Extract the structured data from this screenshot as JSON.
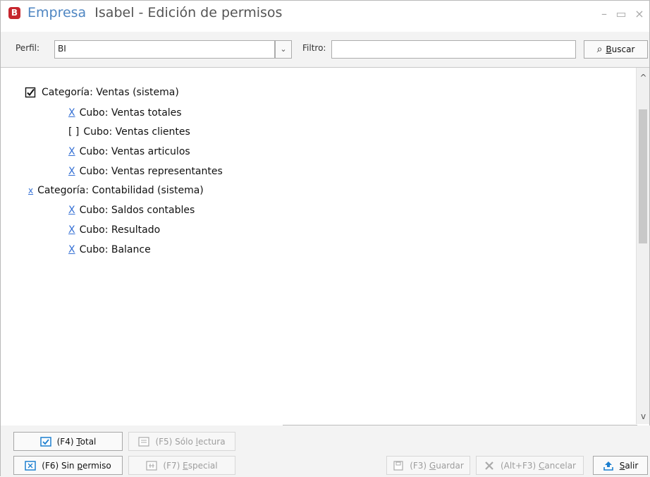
{
  "window": {
    "title_company": "Empresa",
    "title_rest": "Isabel - Edición de permisos",
    "app_icon": "company-logo-icon",
    "minimize_glyph": "–",
    "maximize_glyph": "▭",
    "close_glyph": "×"
  },
  "toolbar": {
    "perfil_label": "Perfil:",
    "perfil_value": "BI",
    "filtro_label": "Filtro:",
    "filtro_value": "",
    "buscar_icon": "search-icon",
    "buscar_underlined": "B",
    "buscar_rest": "uscar"
  },
  "tree": [
    {
      "type": "category",
      "status": "checked",
      "mark": "",
      "label": "Categoría: Ventas (sistema)"
    },
    {
      "type": "cube",
      "status": "full",
      "mark": "X",
      "label": "Cubo: Ventas totales"
    },
    {
      "type": "cube",
      "status": "none",
      "mark": "[ ]",
      "label": "Cubo: Ventas clientes"
    },
    {
      "type": "cube",
      "status": "full",
      "mark": "X",
      "label": "Cubo: Ventas articulos"
    },
    {
      "type": "cube",
      "status": "full",
      "mark": "X",
      "label": "Cubo: Ventas representantes"
    },
    {
      "type": "category",
      "status": "partial",
      "mark": "x",
      "label": "Categoría: Contabilidad (sistema)"
    },
    {
      "type": "cube",
      "status": "full",
      "mark": "X",
      "label": "Cubo: Saldos contables"
    },
    {
      "type": "cube",
      "status": "full",
      "mark": "X",
      "label": "Cubo: Resultado"
    },
    {
      "type": "cube",
      "status": "full",
      "mark": "X",
      "label": "Cubo: Balance"
    }
  ],
  "scrollbar": {
    "up": "^",
    "down": "v"
  },
  "buttons": {
    "total": {
      "prefix": "(F4) ",
      "underlined": "T",
      "rest": "otal",
      "icon": "checkbox-icon"
    },
    "solo_lectura": {
      "prefix": "(F5) Sólo ",
      "underlined": "l",
      "rest": "ectura",
      "icon": "readonly-icon"
    },
    "sin_permiso": {
      "prefix": "(F6) Sin ",
      "underlined": "p",
      "rest": "ermiso",
      "icon": "no-permission-icon"
    },
    "especial": {
      "prefix": "(F7) ",
      "underlined": "E",
      "rest": "special",
      "icon": "special-icon"
    },
    "guardar": {
      "prefix": "(F3) ",
      "underlined": "G",
      "rest": "uardar",
      "icon": "save-icon"
    },
    "cancelar": {
      "prefix": "(Alt+F3) ",
      "underlined": "C",
      "rest": "ancelar",
      "icon": "cancel-icon"
    },
    "salir": {
      "prefix": "",
      "underlined": "S",
      "rest": "alir",
      "icon": "exit-icon"
    }
  },
  "colors": {
    "accent": "#3570d4",
    "title_accent": "#4f86c2",
    "logo": "#c6262e"
  }
}
